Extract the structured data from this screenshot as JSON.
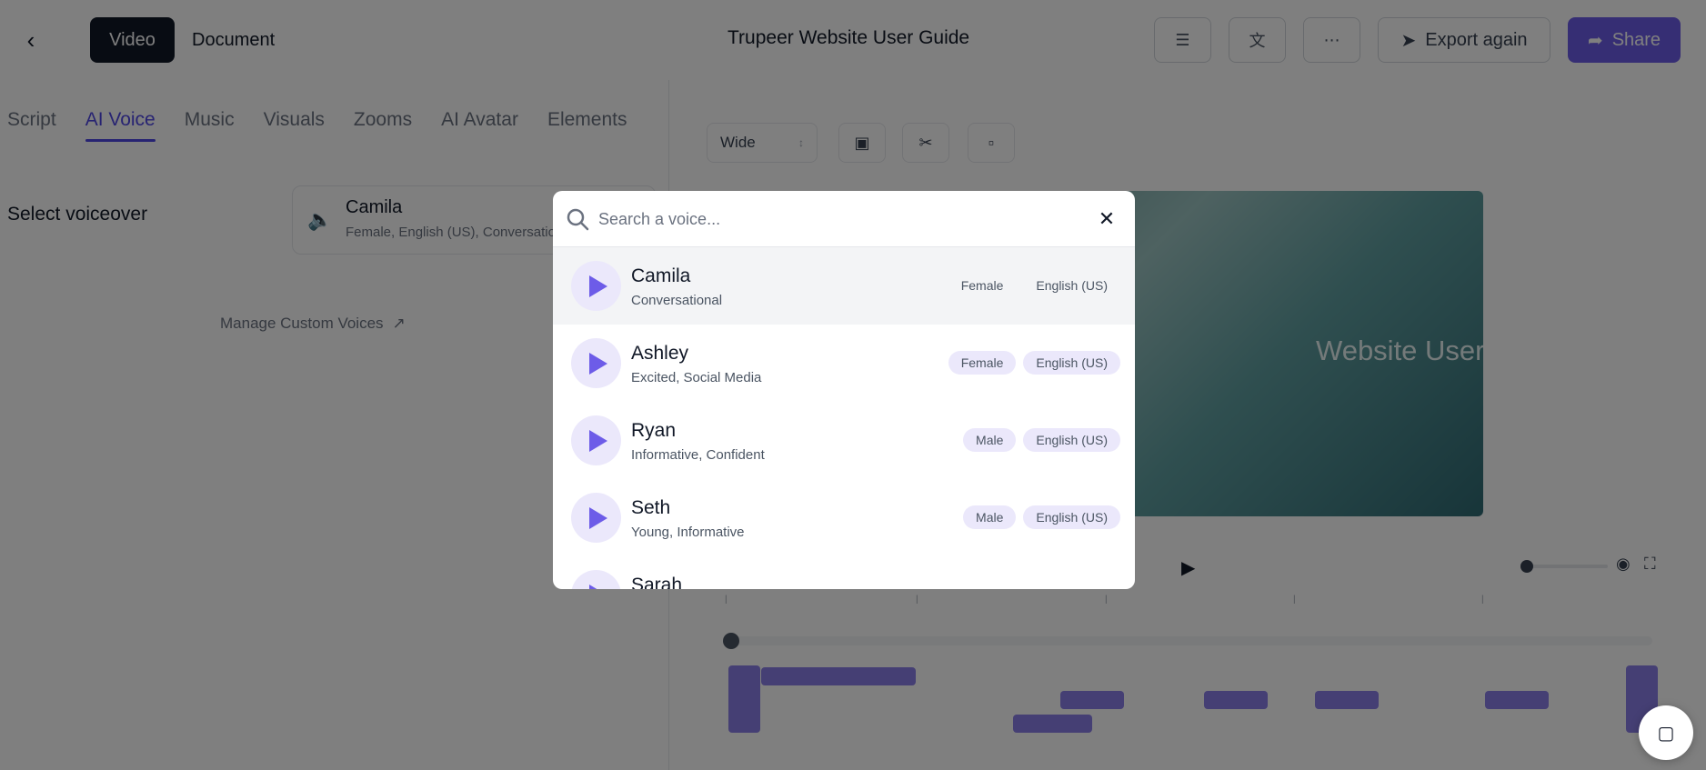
{
  "header": {
    "title": "Trupeer Website User Guide",
    "modes": [
      "Video",
      "Document"
    ],
    "export_label": "Export again",
    "share_label": "Share"
  },
  "tabs": [
    "Script",
    "AI Voice",
    "Music",
    "Visuals",
    "Zooms",
    "AI Avatar",
    "Elements"
  ],
  "active_tab": "AI Voice",
  "left": {
    "select_label": "Select voiceover",
    "current_voice": {
      "name": "Camila",
      "meta": "Female, English (US), Conversational"
    },
    "manage_link": "Manage Custom Voices"
  },
  "preview": {
    "aspect": "Wide",
    "video_title": "Website User Guide"
  },
  "modal": {
    "search_placeholder": "Search a voice...",
    "voices": [
      {
        "name": "Camila",
        "desc": "Conversational",
        "gender": "Female",
        "lang": "English (US)",
        "selected": true
      },
      {
        "name": "Ashley",
        "desc": "Excited, Social Media",
        "gender": "Female",
        "lang": "English (US)"
      },
      {
        "name": "Ryan",
        "desc": "Informative, Confident",
        "gender": "Male",
        "lang": "English (US)"
      },
      {
        "name": "Seth",
        "desc": "Young, Informative",
        "gender": "Male",
        "lang": "English (US)"
      },
      {
        "name": "Sarah",
        "desc": "",
        "gender": "",
        "lang": ""
      }
    ]
  },
  "colors": {
    "accent": "#6d5ce8",
    "dark": "#111827"
  }
}
